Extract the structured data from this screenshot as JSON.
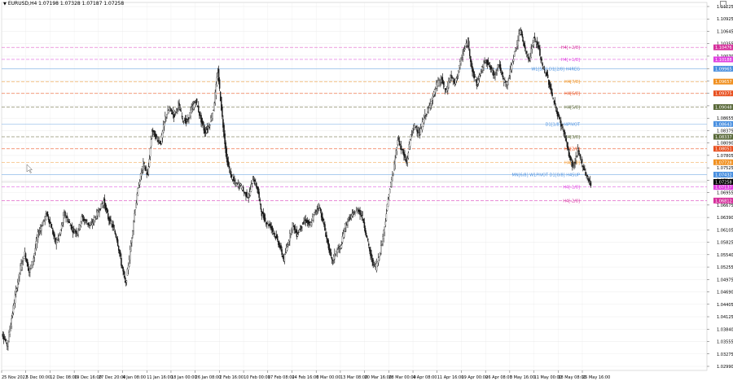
{
  "header": {
    "symbol_line": "EURUSD,H4  1.07198 1.07328 1.07187 1.07258"
  },
  "colors": {
    "candle": "#1a1a1a",
    "background": "#ffffff",
    "grid": "#e6e6e6",
    "price_tag_current": "#000000"
  },
  "chart_data": {
    "type": "line",
    "title": "",
    "xlabel": "",
    "ylabel": "",
    "ylim": [
      1.0275,
      1.1155
    ],
    "grid": true,
    "y_ticks": [
      "1.11225",
      "1.10925",
      "1.10645",
      "1.10355",
      "1.10070",
      "1.09790",
      "1.09505",
      "1.09225",
      "1.08940",
      "1.08655",
      "1.08375",
      "1.08090",
      "1.07805",
      "1.07525",
      "1.07240",
      "1.06955",
      "1.06675",
      "1.06390",
      "1.06105",
      "1.05825",
      "1.05540",
      "1.05255",
      "1.04975",
      "1.04690",
      "1.04405",
      "1.04125",
      "1.03840",
      "1.03555",
      "1.03275",
      "1.02990"
    ],
    "x_ticks": [
      "25 Nov 2022",
      "5 Dec 00:00",
      "12 Dec 08:00",
      "19 Dec 16:00",
      "27 Dec 20:00",
      "4 Jan 08:00",
      "11 Jan 16:00",
      "18 Jan 00:00",
      "26 Jan 08:00",
      "2 Feb 16:00",
      "10 Feb 00:00",
      "17 Feb 08:00",
      "24 Feb 16:00",
      "6 Mar 00:00",
      "13 Mar 08:00",
      "20 Mar 16:00",
      "28 Mar 00:00",
      "4 Apr 08:00",
      "11 Apr 16:00",
      "19 Apr 00:00",
      "26 Apr 08:00",
      "3 May 16:00",
      "11 May 00:00",
      "18 May 08:00",
      "25 May 16:00"
    ],
    "series": [
      {
        "values": [
          1.036,
          1.0335,
          1.04,
          1.0465,
          1.052,
          1.0555,
          1.051,
          1.0545,
          1.06,
          1.0625,
          1.065,
          1.062,
          1.058,
          1.06,
          1.065,
          1.063,
          1.061,
          1.0605,
          1.064,
          1.063,
          1.062,
          1.064,
          1.066,
          1.068,
          1.064,
          1.062,
          1.059,
          1.053,
          1.048,
          1.056,
          1.065,
          1.072,
          1.077,
          1.074,
          1.085,
          1.083,
          1.082,
          1.088,
          1.09,
          1.0885,
          1.091,
          1.0875,
          1.087,
          1.09,
          1.092,
          1.088,
          1.0845,
          1.086,
          1.09,
          1.099,
          1.088,
          1.078,
          1.074,
          1.072,
          1.072,
          1.07,
          1.069,
          1.0735,
          1.071,
          1.065,
          1.063,
          1.062,
          1.06,
          1.0575,
          1.054,
          1.058,
          1.0625,
          1.06,
          1.062,
          1.0635,
          1.062,
          1.065,
          1.067,
          1.063,
          1.058,
          1.0535,
          1.056,
          1.057,
          1.062,
          1.064,
          1.065,
          1.066,
          1.064,
          1.059,
          1.054,
          1.052,
          1.056,
          1.062,
          1.07,
          1.075,
          1.083,
          1.08,
          1.077,
          1.084,
          1.086,
          1.084,
          1.088,
          1.09,
          1.093,
          1.096,
          1.097,
          1.094,
          1.098,
          1.096,
          1.1,
          1.104,
          1.106,
          1.099,
          1.096,
          1.099,
          1.102,
          1.1,
          1.098,
          1.101,
          1.097,
          1.096,
          1.101,
          1.105,
          1.109,
          1.104,
          1.102,
          1.107,
          1.105,
          1.1,
          1.098,
          1.094,
          1.09,
          1.087,
          1.084,
          1.079,
          1.076,
          1.08,
          1.077,
          1.074,
          1.072
        ]
      }
    ],
    "levels": [
      {
        "label": "H4[+2/8]",
        "price_tag": "1.10476",
        "price": 1.10476,
        "color": "#e066c8",
        "tag_color": "#d6309c",
        "dash": true
      },
      {
        "label": "H4[+1/8]",
        "price_tag": "1.10188",
        "price": 1.10188,
        "color": "#e066e0",
        "tag_color": "#e040e0",
        "dash": true
      },
      {
        "label": "W1[5/8] D1[2/8] H4REG",
        "price_tag": "1.09965",
        "price": 1.09965,
        "color": "#90bce8",
        "tag_color": "#4a90e0",
        "dash": false
      },
      {
        "label": "H4[7/8]",
        "price_tag": "1.09657",
        "price": 1.09657,
        "color": "#f4b060",
        "tag_color": "#f09020",
        "dash": true
      },
      {
        "label": "H4[6/8]",
        "price_tag": "1.09375",
        "price": 1.09375,
        "color": "#f07850",
        "tag_color": "#e85020",
        "dash": true
      },
      {
        "label": "H4[5/8]",
        "price_tag": "1.09048",
        "price": 1.09048,
        "color": "#909070",
        "tag_color": "#5a6a3a",
        "dash": true
      },
      {
        "label": "D1[1/8] H4PIVOT",
        "price_tag": "1.08643",
        "price": 1.08643,
        "color": "#90bce8",
        "tag_color": "#4a90e0",
        "dash": false
      },
      {
        "label": "H4[3/8]",
        "price_tag": "1.08337",
        "price": 1.08337,
        "color": "#909070",
        "tag_color": "#5a6a3a",
        "dash": true
      },
      {
        "label": "H4[2/8]",
        "price_tag": "1.08051",
        "price": 1.08051,
        "color": "#f07850",
        "tag_color": "#e85020",
        "dash": true
      },
      {
        "label": "H4[1/8]",
        "price_tag": "1.07728",
        "price": 1.07728,
        "color": "#f4b060",
        "tag_color": "#f09020",
        "dash": true
      },
      {
        "label": "MN[6/8] W1PIVOT D1[0/8] H4SUP",
        "price_tag": "1.07432",
        "price": 1.07432,
        "color": "#90bce8",
        "tag_color": "#4a90e0",
        "dash": false
      },
      {
        "label": "H4[-1/8]",
        "price_tag": "1.07137",
        "price": 1.07137,
        "color": "#e066e0",
        "tag_color": "#e040e0",
        "dash": true
      },
      {
        "label": "H4[-2/8]",
        "price_tag": "1.06812",
        "price": 1.06812,
        "color": "#e066c8",
        "tag_color": "#d6309c",
        "dash": true
      }
    ],
    "current_price_tag": "1.07258",
    "current_price": 1.07258
  }
}
